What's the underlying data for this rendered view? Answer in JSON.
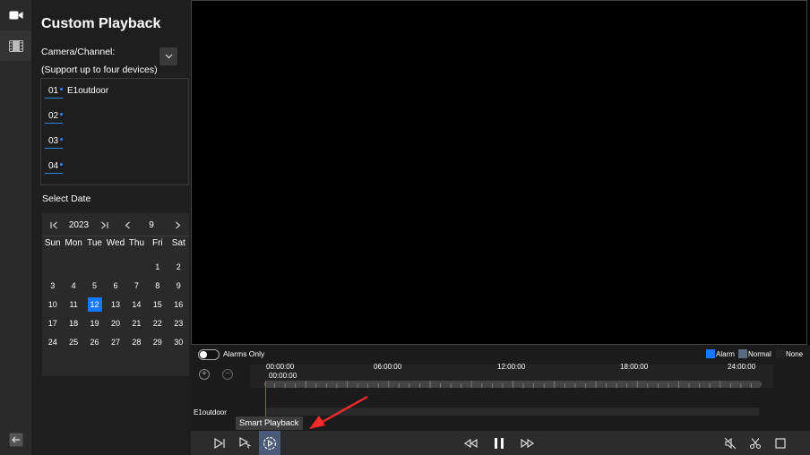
{
  "panel": {
    "title": "Custom Playback",
    "camera_label": "Camera/Channel:",
    "camera_support": "(Support up to four devices)",
    "channels": [
      {
        "num": "01",
        "name": "E1outdoor"
      },
      {
        "num": "02",
        "name": ""
      },
      {
        "num": "03",
        "name": ""
      },
      {
        "num": "04",
        "name": ""
      }
    ],
    "select_date": "Select Date"
  },
  "calendar": {
    "year": "2023",
    "month": "9",
    "weekdays": [
      "Sun",
      "Mon",
      "Tue",
      "Wed",
      "Thu",
      "Fri",
      "Sat"
    ],
    "weeks": [
      [
        "",
        "",
        "",
        "",
        "",
        "1",
        "2"
      ],
      [
        "3",
        "4",
        "5",
        "6",
        "7",
        "8",
        "9"
      ],
      [
        "10",
        "11",
        "12",
        "13",
        "14",
        "15",
        "16"
      ],
      [
        "17",
        "18",
        "19",
        "20",
        "21",
        "22",
        "23"
      ],
      [
        "24",
        "25",
        "26",
        "27",
        "28",
        "29",
        "30"
      ]
    ],
    "selected_day": "12"
  },
  "timeline": {
    "alarms_only": "Alarms Only",
    "legend": [
      {
        "label": "Alarm",
        "color": "#1677ff"
      },
      {
        "label": "Normal",
        "color": "#5a6a80"
      },
      {
        "label": "None",
        "color": "#222222"
      }
    ],
    "ticks": [
      "00:00:00",
      "06:00:00",
      "12:00:00",
      "18:00:00",
      "24:00:00"
    ],
    "cursor_time": "00:00:00",
    "device": "E1outdoor",
    "tooltip": "Smart Playback"
  },
  "colors": {
    "accent": "#1677ff",
    "playhead": "#ff3030",
    "annotation": "#ff2a2a"
  }
}
